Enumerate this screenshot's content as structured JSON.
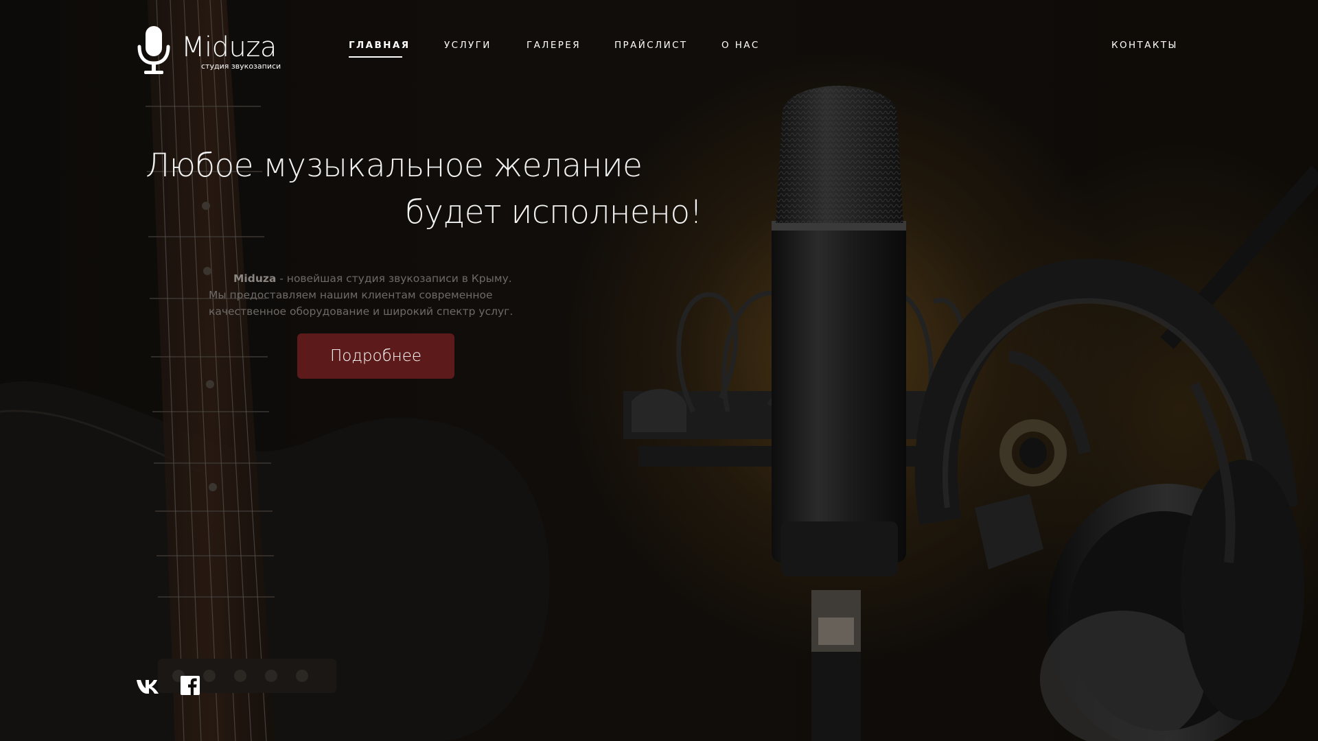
{
  "brand": {
    "name": "Miduza",
    "tagline": "студия звукозаписи",
    "icon": "microphone-icon"
  },
  "nav": {
    "items": [
      {
        "label": "ГЛАВНАЯ",
        "active": true
      },
      {
        "label": "УСЛУГИ"
      },
      {
        "label": "ГАЛЕРЕЯ"
      },
      {
        "label": "ПРАЙСЛИСТ"
      },
      {
        "label": "О НАС"
      }
    ],
    "contacts_label": "КОНТАКТЫ"
  },
  "hero": {
    "line1": "Любое музыкальное желание",
    "line2": "будет исполнено!",
    "brand_word": "Miduza",
    "description_rest": " - новейшая студия звукозаписи в Крыму. Мы предоставляем нашим клиентам современное качественное оборудование и широкий спектр услуг.",
    "button_label": "Подробнее",
    "button_color": "#5c1a1a"
  },
  "social": {
    "icons": [
      "vk-icon",
      "facebook-icon"
    ]
  }
}
